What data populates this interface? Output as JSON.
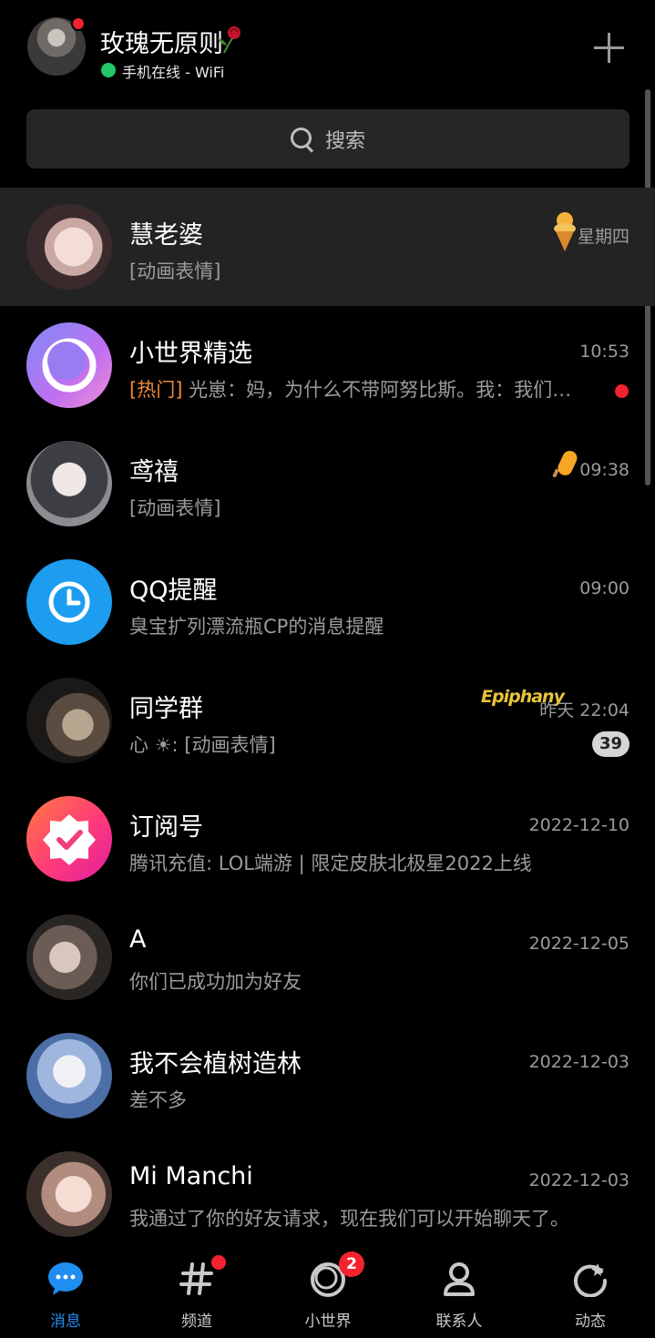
{
  "header": {
    "name": "玫瑰无原则",
    "status": "手机在线 - WiFi"
  },
  "search": {
    "placeholder": "搜索"
  },
  "conversations": [
    {
      "title": "慧老婆",
      "subtitle": "[动画表情]",
      "time": "星期四"
    },
    {
      "title": "小世界精选",
      "tag": "[热门]",
      "subtitle": " 光崽：妈，为什么不带阿努比斯。我：我们是…",
      "time": "10:53"
    },
    {
      "title": "鸢禧",
      "subtitle": "[动画表情]",
      "time": "09:38"
    },
    {
      "title": "QQ提醒",
      "subtitle": "臭宝扩列漂流瓶CP的消息提醒",
      "time": "09:00"
    },
    {
      "title": "同学群",
      "subtitle": "心 ☀: [动画表情]",
      "time": "昨天 22:04",
      "badge": "39",
      "logo_text": "Epiphany"
    },
    {
      "title": "订阅号",
      "subtitle": "腾讯充值: LOL端游 | 限定皮肤北极星2022上线",
      "time": "2022-12-10"
    },
    {
      "title": "A",
      "subtitle": "你们已成功加为好友",
      "time": "2022-12-05"
    },
    {
      "title": "我不会植树造林",
      "subtitle": "差不多",
      "time": "2022-12-03"
    },
    {
      "title": "Mi Manchi",
      "subtitle": "我通过了你的好友请求，现在我们可以开始聊天了。",
      "time": "2022-12-03"
    }
  ],
  "tabs": [
    {
      "label": "消息",
      "icon": "chat-bubble-icon",
      "active": true
    },
    {
      "label": "频道",
      "icon": "hashtag-icon"
    },
    {
      "label": "小世界",
      "icon": "world-ring-icon",
      "badge": "2"
    },
    {
      "label": "联系人",
      "icon": "person-icon"
    },
    {
      "label": "动态",
      "icon": "refresh-star-icon"
    }
  ],
  "colors": {
    "accent": "#1f8ef1",
    "background": "#000000",
    "pinned_row": "#232323",
    "unread": "#f2232e",
    "online": "#22c76a",
    "hot_tag": "#f08a3a"
  }
}
